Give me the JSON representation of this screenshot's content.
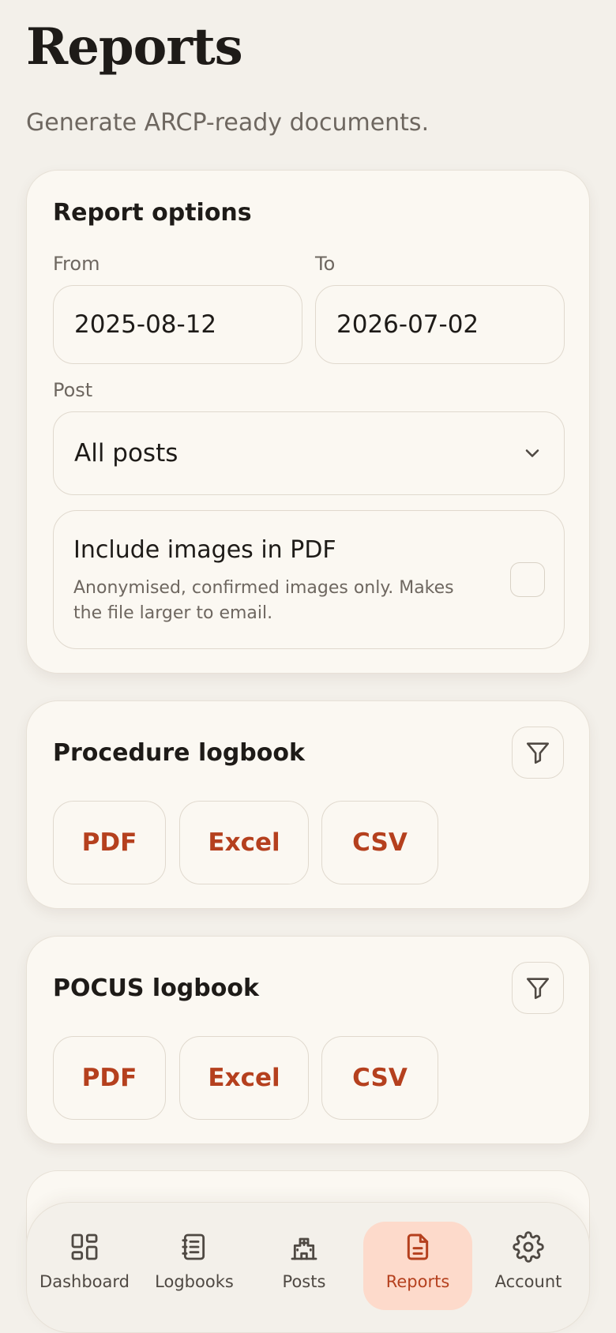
{
  "header": {
    "title": "Reports",
    "subtitle": "Generate ARCP-ready documents."
  },
  "options": {
    "title": "Report options",
    "from_label": "From",
    "from_value": "2025-08-12",
    "to_label": "To",
    "to_value": "2026-07-02",
    "post_label": "Post",
    "post_value": "All posts",
    "include_images": {
      "title": "Include images in PDF",
      "description": "Anonymised, confirmed images only. Makes the file larger to email.",
      "checked": false
    }
  },
  "procedure": {
    "title": "Procedure logbook",
    "pdf": "PDF",
    "excel": "Excel",
    "csv": "CSV"
  },
  "pocus": {
    "title": "POCUS logbook",
    "pdf": "PDF",
    "excel": "Excel",
    "csv": "CSV"
  },
  "nav": {
    "dashboard": "Dashboard",
    "logbooks": "Logbooks",
    "posts": "Posts",
    "reports": "Reports",
    "account": "Account",
    "active": "Reports"
  },
  "colors": {
    "accent": "#b5401e",
    "active_nav_bg": "#fddacb",
    "background": "#f3f0ea",
    "card": "#fbf8f2"
  }
}
